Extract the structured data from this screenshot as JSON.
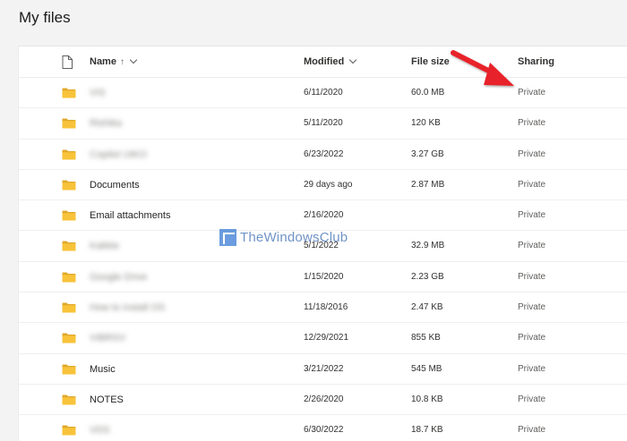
{
  "page": {
    "title": "My files"
  },
  "columns": {
    "name": "Name",
    "name_sort": "↑",
    "modified": "Modified",
    "file_size": "File size",
    "sharing": "Sharing"
  },
  "rows": [
    {
      "name": "VIS",
      "blurred": true,
      "modified": "6/11/2020",
      "size": "60.0 MB",
      "sharing": "Private"
    },
    {
      "name": "Rishika",
      "blurred": true,
      "modified": "5/11/2020",
      "size": "120 KB",
      "sharing": "Private"
    },
    {
      "name": "Copilot UIKO",
      "blurred": true,
      "modified": "6/23/2022",
      "size": "3.27 GB",
      "sharing": "Private"
    },
    {
      "name": "Documents",
      "blurred": false,
      "modified": "29 days ago",
      "size": "2.87 MB",
      "sharing": "Private"
    },
    {
      "name": "Email attachments",
      "blurred": false,
      "modified": "2/16/2020",
      "size": "",
      "sharing": "Private"
    },
    {
      "name": "Kakkie",
      "blurred": true,
      "modified": "5/1/2022",
      "size": "32.9 MB",
      "sharing": "Private"
    },
    {
      "name": "Google Drive",
      "blurred": true,
      "modified": "1/15/2020",
      "size": "2.23 GB",
      "sharing": "Private"
    },
    {
      "name": "How to install OS",
      "blurred": true,
      "modified": "11/18/2016",
      "size": "2.47 KB",
      "sharing": "Private"
    },
    {
      "name": "VIBRSV",
      "blurred": true,
      "modified": "12/29/2021",
      "size": "855 KB",
      "sharing": "Private"
    },
    {
      "name": "Music",
      "blurred": false,
      "modified": "3/21/2022",
      "size": "545 MB",
      "sharing": "Private"
    },
    {
      "name": "NOTES",
      "blurred": false,
      "modified": "2/26/2020",
      "size": "10.8 KB",
      "sharing": "Private"
    },
    {
      "name": "VDS",
      "blurred": true,
      "modified": "6/30/2022",
      "size": "18.7 KB",
      "sharing": "Private"
    }
  ],
  "watermark": {
    "text": "TheWindowsClub"
  },
  "icons": {
    "folder": "folder-icon",
    "file": "file-type-icon",
    "sort": "sort-ascending-icon",
    "chevron": "chevron-down-icon"
  },
  "colors": {
    "folder": "#f8c33a",
    "folder_dark": "#e0a82a",
    "annotation_arrow": "#e8202a"
  }
}
